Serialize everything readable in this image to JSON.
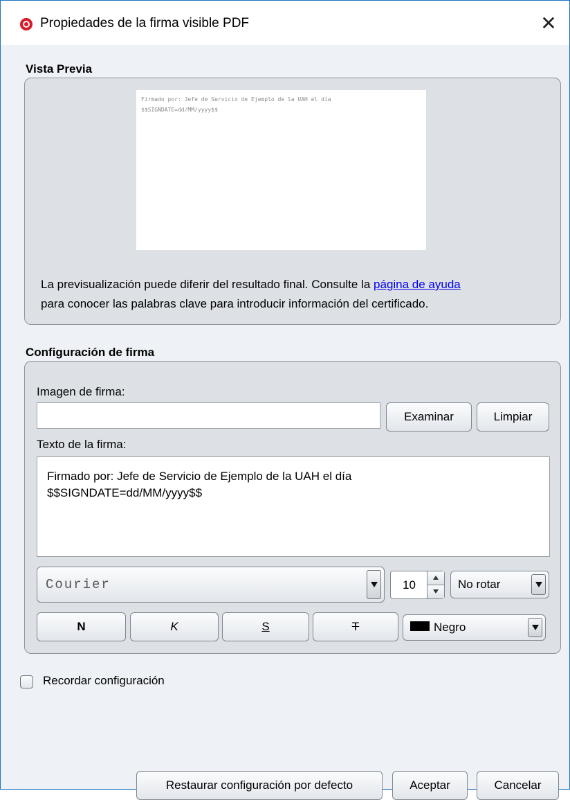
{
  "window": {
    "title": "Propiedades de la firma visible PDF",
    "close_glyph": "✕"
  },
  "preview": {
    "section_title": "Vista Previa",
    "sample_lines": [
      "Firmado por: Jefe de Servicio de Ejemplo de la UAH el día",
      "$$SIGNDATE=dd/MM/yyyy$$"
    ],
    "note_text_1": "La previsualización puede diferir del resultado final. Consulte la",
    "note_link": "página de ayuda",
    "note_text_2": "para conocer las palabras clave para introducir información del certificado."
  },
  "config": {
    "section_title": "Configuración de firma",
    "image_label": "Imagen de firma:",
    "image_value": "",
    "browse_button": "Examinar",
    "clear_button": "Limpiar",
    "text_label": "Texto de la firma:",
    "text_line_1": "Firmado por: Jefe de Servicio de Ejemplo de la UAH el día",
    "text_line_2": "$$SIGNDATE=dd/MM/yyyy$$",
    "font_value": "Courier",
    "size_value": "10",
    "rotation_value": "No rotar",
    "bold_label": "N",
    "italic_label": "K",
    "underline_label": "S",
    "strike_label": "T",
    "color_value": "Negro",
    "color_swatch": "#000000"
  },
  "remember": {
    "label": "Recordar configuración",
    "checked": false
  },
  "footer": {
    "restore_button": "Restaurar configuración por defecto",
    "accept_button": "Aceptar",
    "cancel_button": "Cancelar"
  },
  "colors": {
    "link": "#0000ee",
    "window_border": "#1b74c2",
    "app_icon": "#d71c27"
  }
}
